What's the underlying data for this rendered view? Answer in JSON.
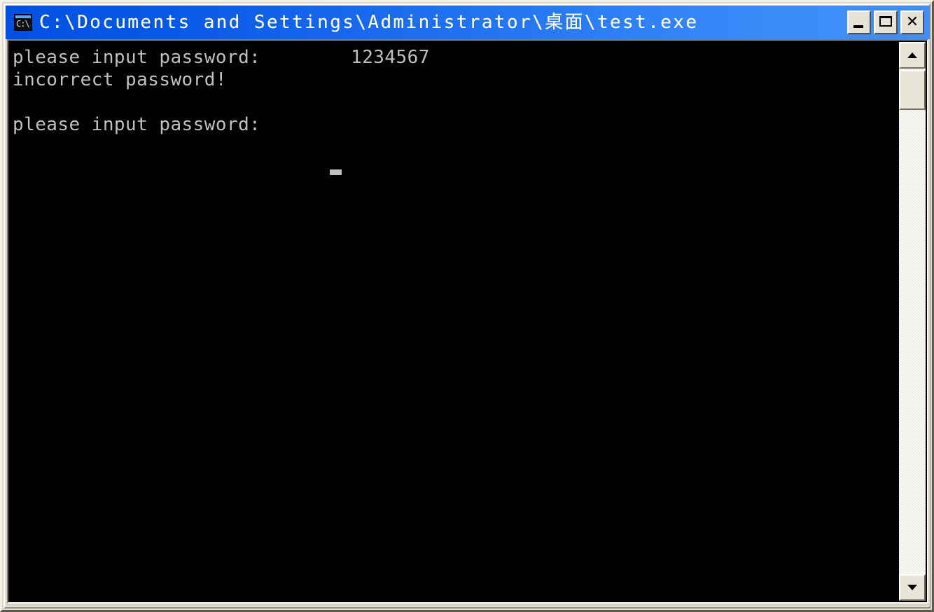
{
  "window": {
    "title": "C:\\Documents and Settings\\Administrator\\桌面\\test.exe",
    "icon_name": "console-app-icon",
    "icon_text": "C:\\",
    "colors": {
      "titlebar_left": "#0050e4",
      "titlebar_right": "#3e8ffa",
      "frame": "#d8d4c8",
      "console_background": "#000000",
      "console_foreground": "#c0c0c0"
    },
    "controls": {
      "minimize_label": "Minimize",
      "maximize_label": "Maximize",
      "close_label": "Close",
      "close_glyph": "✕"
    }
  },
  "console": {
    "lines": [
      "please input password:        1234567",
      "incorrect password!",
      "",
      "please input password:"
    ],
    "text": "please input password:        1234567\nincorrect password!\n\nplease input password:",
    "prompt": "please input password:",
    "entered_password": "1234567",
    "error_message": "incorrect password!",
    "cursor_visible": true
  },
  "scrollbar": {
    "up_arrow": "▲",
    "down_arrow": "▼",
    "orientation": "vertical",
    "thumb_position": "top"
  }
}
